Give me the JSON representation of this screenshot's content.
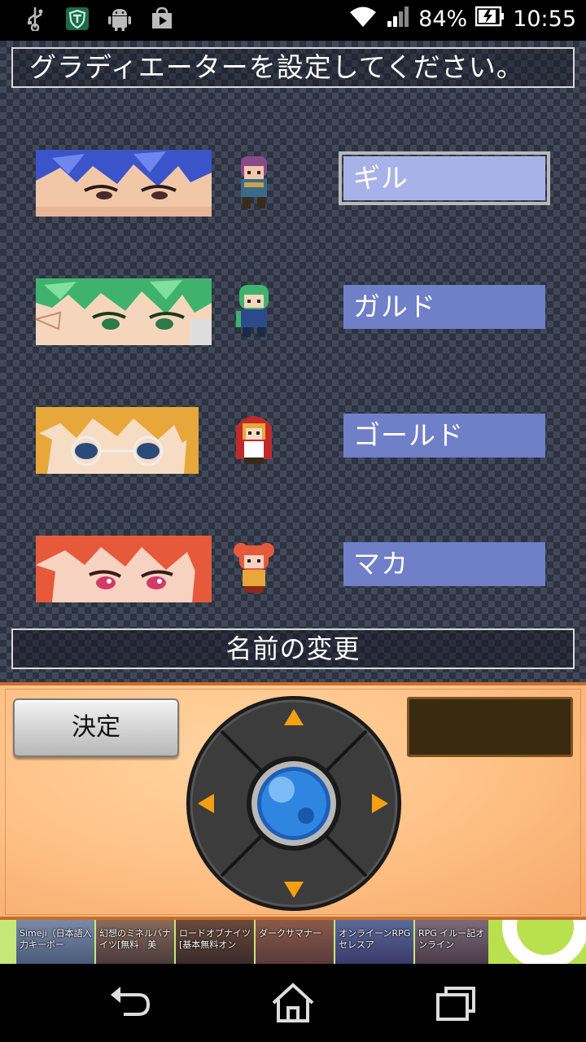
{
  "status_bar": {
    "battery_percent": "84%",
    "time": "10:55",
    "icons": [
      "usb-icon",
      "shield-app-icon",
      "android-icon",
      "play-store-icon",
      "wifi-icon",
      "signal-icon",
      "battery-charging-icon"
    ]
  },
  "screen": {
    "title": "グラディエーターを設定してください。",
    "characters": [
      {
        "name": "ギル",
        "selected": true,
        "hair_color": "#3b54c9"
      },
      {
        "name": "ガルド",
        "selected": false,
        "hair_color": "#3fb36d"
      },
      {
        "name": "ゴールド",
        "selected": false,
        "hair_color": "#e8a73a"
      },
      {
        "name": "マカ",
        "selected": false,
        "hair_color": "#e65a3b"
      }
    ],
    "change_name_label": "名前の変更"
  },
  "controller": {
    "decide_label": "決定",
    "dpad_icons": [
      "arrow-up-icon",
      "arrow-left-icon",
      "arrow-right-icon",
      "arrow-down-icon",
      "center-orb-icon"
    ]
  },
  "ad_banner": {
    "items": [
      "Simeji（日本語入力キーボー",
      "幻想のミネルバナイツ[無料　美",
      "ロードオブナイツ[基本無料オン",
      "ダークサマナー",
      "オンライーンRPGセレスア",
      "RPG イルー記オンライン"
    ]
  },
  "nav_bar": {
    "icons": [
      "back-icon",
      "home-icon",
      "recents-icon"
    ]
  },
  "colors": {
    "name_box": "#6f7fc8",
    "name_box_selected": "#a9b2e8",
    "pad_orange": "#ffc48a",
    "arrow_orange": "#f5a011"
  }
}
